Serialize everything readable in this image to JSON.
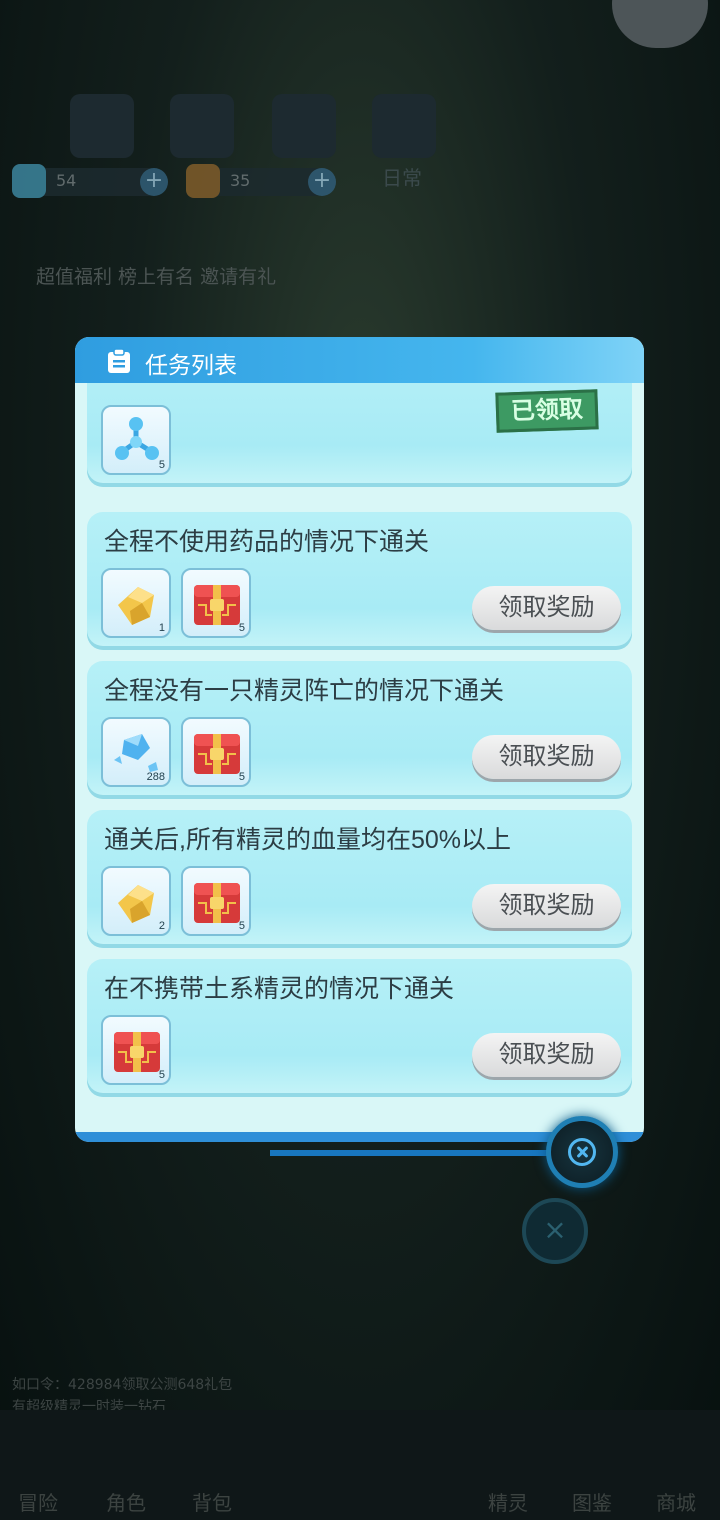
{
  "background": {
    "resources": [
      {
        "value": "54",
        "icon": "gem-icon"
      },
      {
        "value": "35",
        "icon": "ticket-icon"
      }
    ],
    "tab_daily": "日常",
    "marquee": "超值福利 榜上有名 邀请有礼",
    "info_line_1": "如口令：428984领取公测648礼包",
    "info_line_2": "有超级精灵一时装一钻石",
    "nav": [
      "冒险",
      "角色",
      "背包",
      "精灵",
      "图鉴",
      "商城"
    ]
  },
  "modal": {
    "title": "任务列表",
    "header_icon": "clipboard-icon",
    "tasks": [
      {
        "title": "",
        "state": "claimed",
        "status_label": "已领取",
        "rewards": [
          {
            "icon": "molecule-icon",
            "count": "5"
          }
        ]
      },
      {
        "title": "全程不使用药品的情况下通关",
        "state": "claimable",
        "button_label": "领取奖励",
        "rewards": [
          {
            "icon": "gold-ingot-icon",
            "count": "1"
          },
          {
            "icon": "treasure-chest-icon",
            "count": "5"
          }
        ]
      },
      {
        "title": "全程没有一只精灵阵亡的情况下通关",
        "state": "claimable",
        "button_label": "领取奖励",
        "rewards": [
          {
            "icon": "crystal-icon",
            "count": "288"
          },
          {
            "icon": "treasure-chest-icon",
            "count": "5"
          }
        ]
      },
      {
        "title": "通关后,所有精灵的血量均在50%以上",
        "state": "claimable",
        "button_label": "领取奖励",
        "rewards": [
          {
            "icon": "gold-ingot-icon",
            "count": "2"
          },
          {
            "icon": "treasure-chest-icon",
            "count": "5"
          }
        ]
      },
      {
        "title": "在不携带土系精灵的情况下通关",
        "state": "claimable",
        "button_label": "领取奖励",
        "rewards": [
          {
            "icon": "treasure-chest-icon",
            "count": "5"
          }
        ]
      }
    ],
    "close_icon": "close-icon"
  },
  "colors": {
    "header": "#2f9de0",
    "card": "#b6f0f7",
    "stamp": "#3d9a63",
    "close_ring": "#1f7fb4"
  }
}
